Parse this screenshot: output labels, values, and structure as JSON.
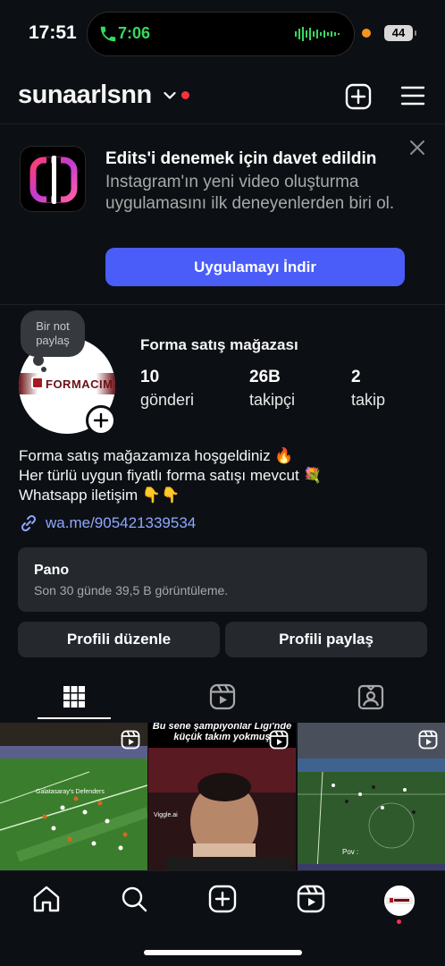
{
  "status_bar": {
    "time": "17:51",
    "call_time": "7:06",
    "battery": "44"
  },
  "header": {
    "username": "sunaarlsnn"
  },
  "invite": {
    "title": "Edits'i denemek için davet edildin",
    "text": "Instagram'ın yeni video oluşturma uygulamasını ilk deneyenlerden biri ol.",
    "button": "Uygulamayı İndir"
  },
  "profile": {
    "note": "Bir not paylaş",
    "avatar_text": "FORMACIM",
    "display_name": "Forma satış mağazası",
    "stats": [
      {
        "value": "10",
        "label": "gönderi"
      },
      {
        "value": "26B",
        "label": "takipçi"
      },
      {
        "value": "2",
        "label": "takip"
      }
    ],
    "bio": "Forma satış mağazamıza hoşgeldiniz 🔥\nHer türlü uygun fiyatlı forma satışı mevcut 💐\nWhatsapp iletişim 👇👇",
    "link": "wa.me/905421339534"
  },
  "dashboard": {
    "title": "Pano",
    "subtitle": "Son 30 günde 39,5 B görüntüleme."
  },
  "buttons": {
    "edit": "Profili düzenle",
    "share": "Profili paylaş"
  },
  "tabs": [
    "grid-icon",
    "reels-icon",
    "tagged-icon"
  ],
  "grid": [
    {
      "caption": "",
      "tag": "Galatasaray's Defenders"
    },
    {
      "caption": "Bu sene şampiyonlar Ligi'nde küçük takım yokmuş",
      "tag": "Viggle.ai"
    },
    {
      "caption": "",
      "tag": "Pov :"
    }
  ],
  "nav": [
    "home-icon",
    "search-icon",
    "create-icon",
    "reels-icon",
    "profile-avatar"
  ],
  "colors": {
    "accent": "#4a5df9",
    "background": "#0c1014",
    "link": "#8fa7ff",
    "notification": "#ff3040"
  }
}
